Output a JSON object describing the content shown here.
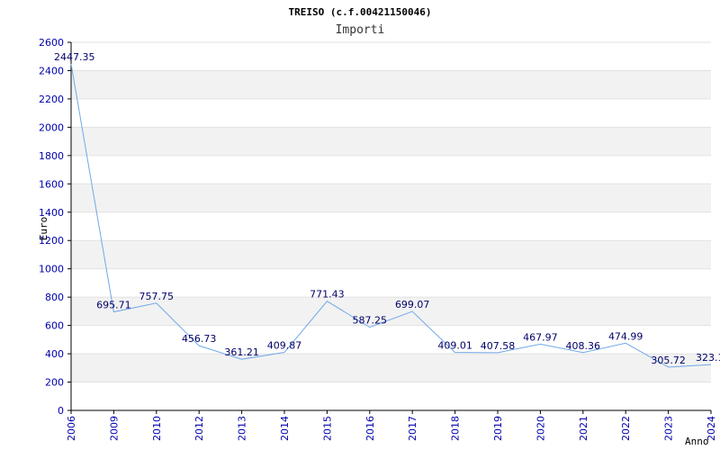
{
  "chart_data": {
    "type": "line",
    "title": "TREISO (c.f.00421150046)",
    "subtitle": "Importi",
    "xlabel": "Anno",
    "ylabel": "Euro",
    "ylim": [
      0,
      2600
    ],
    "yticks": [
      0,
      200,
      400,
      600,
      800,
      1000,
      1200,
      1400,
      1600,
      1800,
      2000,
      2200,
      2400,
      2600
    ],
    "grid": "alternating horizontal bands",
    "categories": [
      "2006",
      "2009",
      "2010",
      "2012",
      "2013",
      "2014",
      "2015",
      "2016",
      "2017",
      "2018",
      "2019",
      "2020",
      "2021",
      "2022",
      "2023",
      "2024"
    ],
    "value_labels": [
      "2447.35",
      "695.71",
      "757.75",
      "456.73",
      "361.21",
      "409.87",
      "771.43",
      "587.25",
      "699.07",
      "409.01",
      "407.58",
      "467.97",
      "408.36",
      "474.99",
      "305.72",
      "323.1"
    ],
    "series": [
      {
        "values": [
          2447.35,
          695.71,
          757.75,
          456.73,
          361.21,
          409.87,
          771.43,
          587.25,
          699.07,
          409.01,
          407.58,
          467.97,
          408.36,
          474.99,
          305.72,
          323.1
        ]
      }
    ],
    "colors": {
      "line": "#6fa8e8",
      "band": "#f2f2f2",
      "axis": "#000000",
      "tick_text": "#0000aa",
      "label_text": "#000066"
    }
  }
}
